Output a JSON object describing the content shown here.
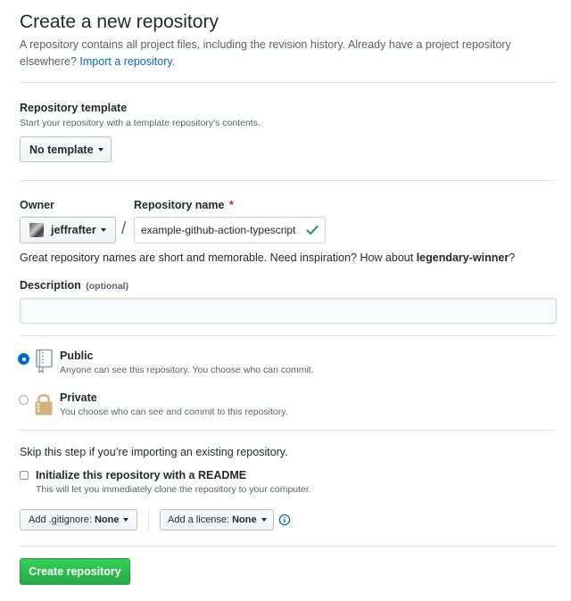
{
  "header": {
    "title": "Create a new repository",
    "intro_text": "A repository contains all project files, including the revision history. Already have a project repository elsewhere?",
    "import_link": "Import a repository."
  },
  "template_section": {
    "label": "Repository template",
    "note": "Start your repository with a template repository's contents.",
    "button_label": "No template"
  },
  "owner": {
    "label": "Owner",
    "value": "jeffrafter"
  },
  "repo_name": {
    "label": "Repository name",
    "required_marker": "*",
    "separator": "/",
    "value": "example-github-action-typescript",
    "hint_prefix": "Great repository names are short and memorable. Need inspiration? How about",
    "suggestion": "legendary-winner",
    "hint_suffix": "?"
  },
  "description": {
    "label": "Description",
    "optional": "(optional)",
    "value": ""
  },
  "visibility": {
    "selected": "public",
    "options": [
      {
        "label": "Public",
        "note": "Anyone can see this repository. You choose who can commit."
      },
      {
        "label": "Private",
        "note": "You choose who can see and commit to this repository."
      }
    ]
  },
  "init": {
    "skip_note": "Skip this step if you’re importing an existing repository.",
    "readme_label": "Initialize this repository with a README",
    "readme_note": "This will let you immediately clone the repository to your computer.",
    "readme_checked": false
  },
  "extras": {
    "gitignore_prefix": "Add .gitignore:",
    "gitignore_value": "None",
    "license_prefix": "Add a license:",
    "license_value": "None"
  },
  "submit": {
    "label": "Create repository"
  },
  "colors": {
    "link": "#0366d6",
    "primary_green": "#28a745",
    "required": "#cb2431",
    "valid": "#28a745"
  },
  "icons": {
    "valid": "check-icon",
    "public": "repo-icon",
    "private": "lock-icon",
    "info": "info-icon"
  }
}
